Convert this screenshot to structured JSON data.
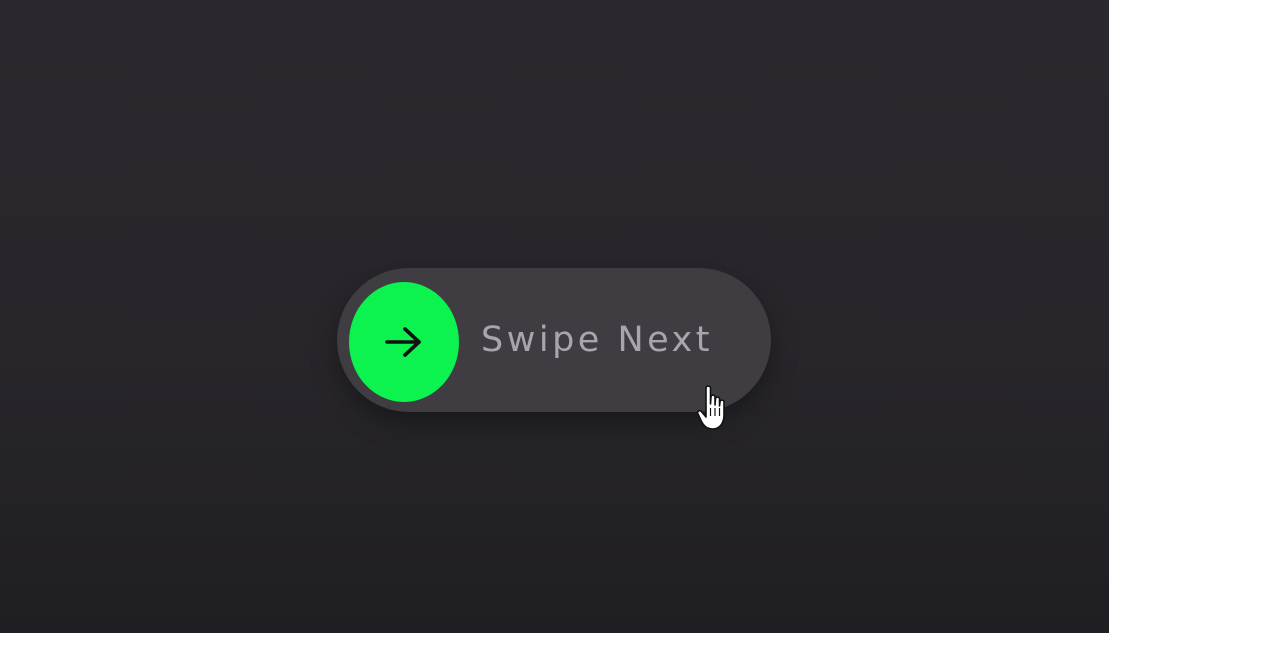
{
  "swipe_button": {
    "label": "Swipe Next",
    "knob_icon": "arrow-right-icon",
    "progress": 0
  },
  "colors": {
    "background": "#28262b",
    "track": "#3f3d42",
    "knob": "#0cf24f",
    "label": "#a8a6ac",
    "icon": "#111111"
  },
  "cursor_icon": "hand-pointer-icon"
}
